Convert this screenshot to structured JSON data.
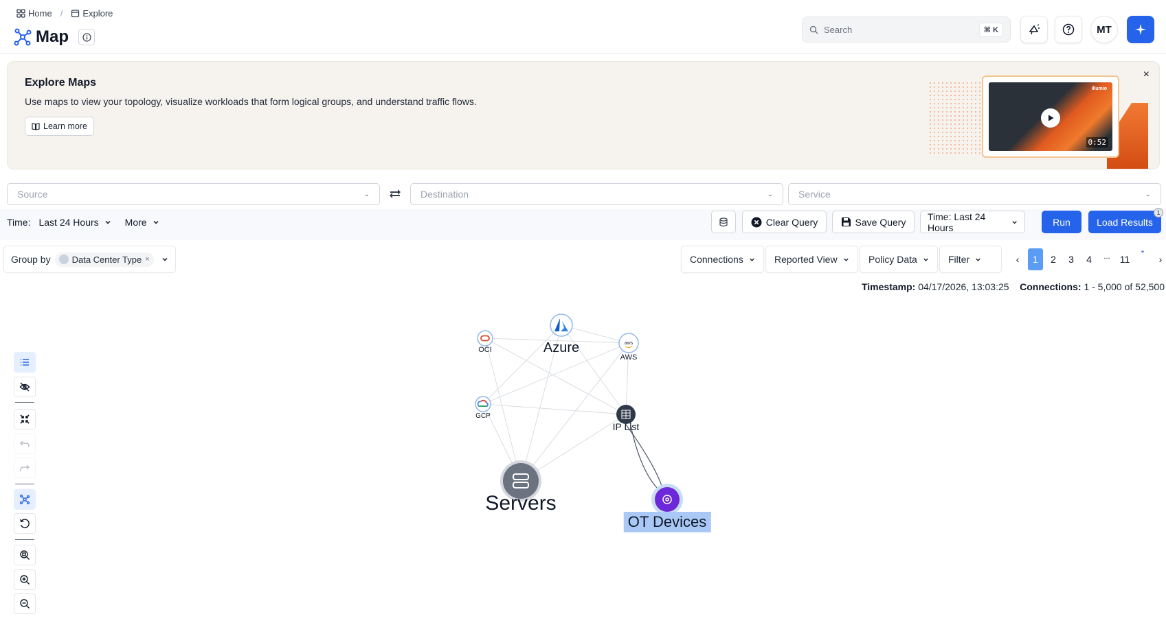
{
  "breadcrumb": {
    "home": "Home",
    "sep": "/",
    "explore": "Explore"
  },
  "page": {
    "title": "Map"
  },
  "search": {
    "placeholder": "Search",
    "shortcut": "⌘ K"
  },
  "user": {
    "initials": "MT"
  },
  "banner": {
    "title": "Explore Maps",
    "text": "Use maps to view your topology, visualize workloads that form logical groups, and understand traffic flows.",
    "learn_more": "Learn more",
    "video_duration": "0:52",
    "video_brand": "illumio",
    "close": "×"
  },
  "query": {
    "source_placeholder": "Source",
    "destination_placeholder": "Destination",
    "service_placeholder": "Service",
    "time_label": "Time:",
    "time_value": "Last 24 Hours",
    "more": "More",
    "clear": "Clear Query",
    "save": "Save Query",
    "time_button": "Time: Last 24 Hours",
    "run": "Run",
    "load": "Load Results",
    "load_badge": "1"
  },
  "groupby": {
    "label": "Group by",
    "chip": "Data Center Type",
    "chip_remove": "×"
  },
  "view": {
    "connections": "Connections",
    "reported": "Reported View",
    "policy": "Policy Data",
    "filter": "Filter"
  },
  "pager": {
    "prev": "‹",
    "pages": [
      "1",
      "2",
      "3",
      "4"
    ],
    "ellipsis": "...",
    "last": "11",
    "star": "*",
    "next": "›",
    "current": "1"
  },
  "stats": {
    "timestamp_label": "Timestamp:",
    "timestamp": "04/17/2026, 13:03:25",
    "connections_label": "Connections:",
    "connections": "1 - 5,000 of 52,500"
  },
  "graph": {
    "nodes": [
      {
        "id": "azure",
        "label": "Azure",
        "icon": "azure-icon"
      },
      {
        "id": "oci",
        "label": "OCI",
        "icon": "oci-icon"
      },
      {
        "id": "aws",
        "label": "AWS",
        "icon": "aws-icon",
        "glyph": "aws"
      },
      {
        "id": "gcp",
        "label": "GCP",
        "icon": "gcp-icon"
      },
      {
        "id": "iplist",
        "label": "IP List",
        "icon": "ip-list-icon"
      },
      {
        "id": "servers",
        "label": "Servers",
        "icon": "servers-icon"
      },
      {
        "id": "ot",
        "label": "OT Devices",
        "icon": "ot-devices-icon",
        "selected": true
      }
    ],
    "edges": [
      [
        "oci",
        "servers"
      ],
      [
        "oci",
        "iplist"
      ],
      [
        "azure",
        "servers"
      ],
      [
        "azure",
        "iplist"
      ],
      [
        "azure",
        "gcp"
      ],
      [
        "aws",
        "servers"
      ],
      [
        "aws",
        "iplist"
      ],
      [
        "aws",
        "gcp"
      ],
      [
        "gcp",
        "servers"
      ],
      [
        "gcp",
        "iplist"
      ],
      [
        "iplist",
        "servers"
      ],
      [
        "oci",
        "aws"
      ],
      [
        "azure",
        "aws"
      ]
    ],
    "colors": {
      "edge": "#d8dde3",
      "selected_bg": "#a9c8f5",
      "ot": "#6d28d9",
      "servers": "#6b7280",
      "iplist": "#2f3a48"
    }
  }
}
